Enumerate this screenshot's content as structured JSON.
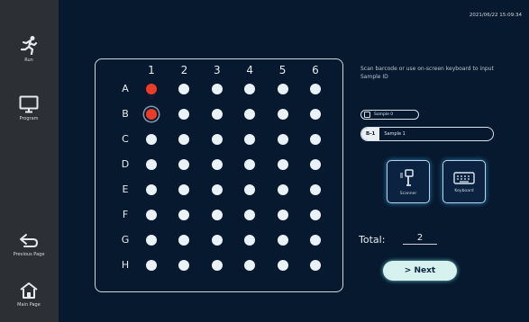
{
  "sidebar": {
    "run_label": "Run",
    "program_label": "Program",
    "previous_label": "Previous Page",
    "main_label": "Main Page"
  },
  "header": {
    "timestamp": "2021/06/22 15:09:34"
  },
  "plate": {
    "columns": [
      "1",
      "2",
      "3",
      "4",
      "5",
      "6"
    ],
    "rows": [
      "A",
      "B",
      "C",
      "D",
      "E",
      "F",
      "G",
      "H"
    ],
    "selected_wells": [
      "A1",
      "B1"
    ],
    "current_well": "B1"
  },
  "instruction": "Scan barcode or use on-screen keyboard to input Sample ID",
  "sample_pill": {
    "label": "Sample 0"
  },
  "sample_input": {
    "tag": "B-1",
    "value": "Sample 1"
  },
  "tools": {
    "scanner_label": "Scanner",
    "keyboard_label": "Keyboard"
  },
  "total": {
    "label": "Total:",
    "value": "2"
  },
  "next_button": "> Next",
  "colors": {
    "accent": "#d7f1ee",
    "selected_well": "#ee3b25",
    "background": "#07192f"
  }
}
